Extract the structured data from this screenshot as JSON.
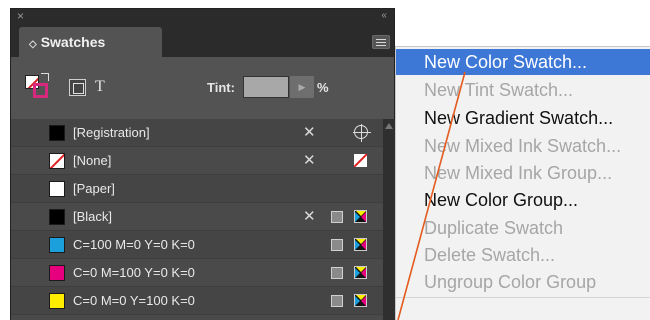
{
  "panel": {
    "close_glyph": "×",
    "collapse_glyph": "‹‹",
    "tab_label": "Swatches",
    "toolbar": {
      "format_text": "T",
      "tint_label": "Tint:",
      "tint_value": "",
      "tint_unit": "%"
    },
    "swatches": [
      {
        "label": "[Registration]",
        "color": "#000000",
        "icons": [
          "no-edit-icon",
          "registration-icon"
        ]
      },
      {
        "label": "[None]",
        "color": "none",
        "icons": [
          "no-edit-icon",
          "none-icon"
        ]
      },
      {
        "label": "[Paper]",
        "color": "#ffffff",
        "icons": []
      },
      {
        "label": "[Black]",
        "color": "#000000",
        "icons": [
          "no-edit-icon",
          "process-icon",
          "cmyk-icon"
        ]
      },
      {
        "label": "C=100 M=0 Y=0 K=0",
        "color": "#1ba0dc",
        "icons": [
          "process-icon",
          "cmyk-icon"
        ]
      },
      {
        "label": "C=0 M=100 Y=0 K=0",
        "color": "#e6007e",
        "icons": [
          "process-icon",
          "cmyk-icon"
        ]
      },
      {
        "label": "C=0 M=0 Y=100 K=0",
        "color": "#ffed00",
        "icons": [
          "process-icon",
          "cmyk-icon"
        ]
      }
    ]
  },
  "menu": {
    "items": [
      {
        "label": "New Color Swatch...",
        "state": "highlighted"
      },
      {
        "label": "New Tint Swatch...",
        "state": "disabled"
      },
      {
        "label": "New Gradient Swatch...",
        "state": "enabled"
      },
      {
        "label": "New Mixed Ink Swatch...",
        "state": "disabled"
      },
      {
        "label": "New Mixed Ink Group...",
        "state": "disabled"
      },
      {
        "label": "New Color Group...",
        "state": "enabled"
      },
      {
        "label": "Duplicate Swatch",
        "state": "disabled"
      },
      {
        "label": "Delete Swatch...",
        "state": "disabled"
      },
      {
        "label": "Ungroup Color Group",
        "state": "disabled"
      }
    ]
  },
  "colors": {
    "panel_bg": "#3a3a3a",
    "menu_highlight": "#3e78d7",
    "callout_line": "#e35b1e"
  }
}
